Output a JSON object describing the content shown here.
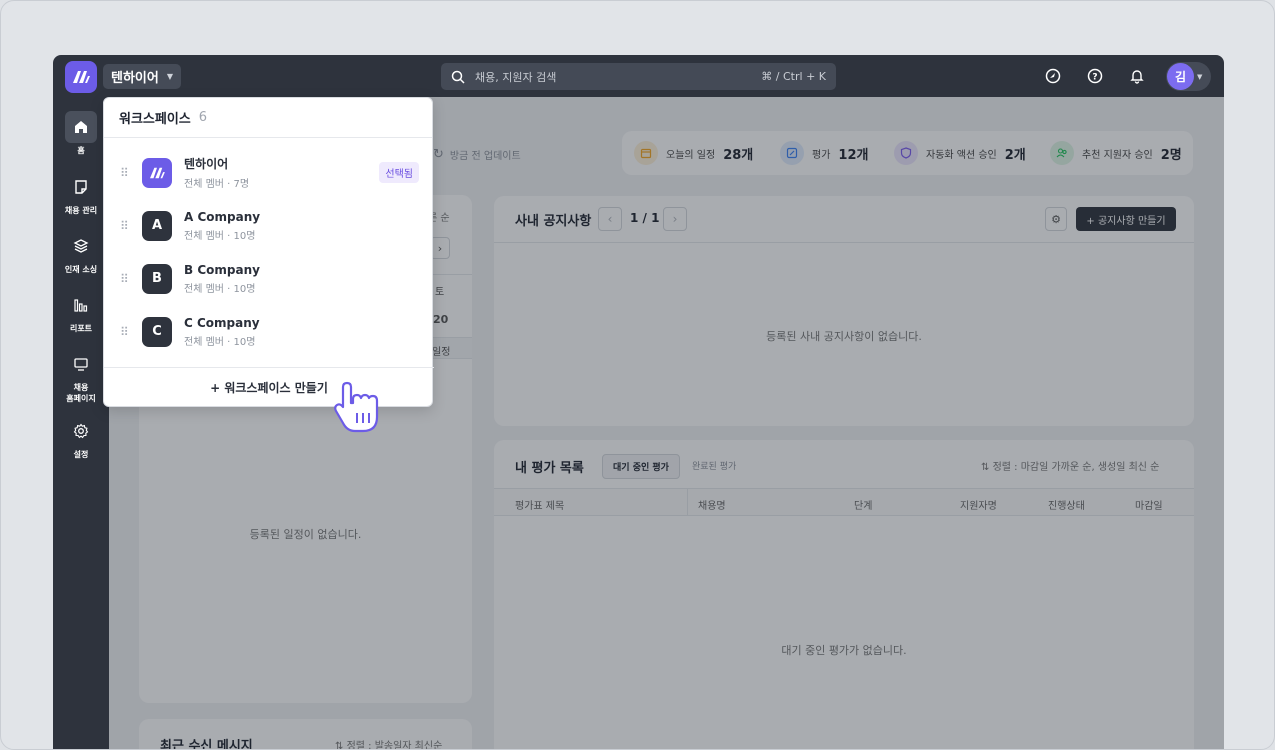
{
  "topbar": {
    "workspace_name": "텐하이어",
    "search_placeholder": "채용, 지원자 검색",
    "search_shortcut": "⌘ / Ctrl + K",
    "avatar_initial": "김"
  },
  "sidebar": {
    "items": [
      {
        "label": "홈",
        "icon": "home-icon"
      },
      {
        "label": "채용 관리",
        "icon": "note-icon"
      },
      {
        "label": "인재 소싱",
        "icon": "layers-icon"
      },
      {
        "label": "리포트",
        "icon": "bar-chart-icon"
      },
      {
        "label": "채용\n홈페이지",
        "icon": "monitor-icon"
      },
      {
        "label": "설정",
        "icon": "gear-icon"
      }
    ]
  },
  "main": {
    "refresh_text": "방금 전 업데이트",
    "stats": [
      {
        "label": "오늘의 일정",
        "value": "28개",
        "color": "#f5a623"
      },
      {
        "label": "평가",
        "value": "12개",
        "color": "#3b82f6"
      },
      {
        "label": "자동화 액션 승인",
        "value": "2개",
        "color": "#7c5cf0"
      },
      {
        "label": "추천 지원자 승인",
        "value": "2명",
        "color": "#22c55e"
      }
    ],
    "calendar": {
      "sort_text": "른 순",
      "day_label": "토",
      "day_number": "20",
      "col_label": "일정",
      "empty_text": "등록된 일정이 없습니다."
    },
    "notice": {
      "title": "사내 공지사항",
      "page": "1 / 1",
      "create_button": "+ 공지사항 만들기",
      "empty_text": "등록된 사내 공지사항이 없습니다."
    },
    "evaluations": {
      "title": "내 평가 목록",
      "tab_waiting": "대기 중인 평가",
      "tab_done": "완료된 평가",
      "sort_text": "정렬 : 마감일 가까운 순, 생성일 최신 순",
      "columns": [
        "평가표 제목",
        "채용명",
        "단계",
        "지원자명",
        "진행상태",
        "마감일"
      ],
      "empty_text": "대기 중인 평가가 없습니다."
    },
    "messages": {
      "title": "최근 수신 메시지",
      "sort_text": "정렬 : 발송일자 최신순"
    }
  },
  "dropdown": {
    "title": "워크스페이스",
    "count": "6",
    "items": [
      {
        "name": "텐하이어",
        "sub": "전체 멤버 · 7명",
        "badge": "선택됨",
        "initial": "",
        "color": "#6c5ce7"
      },
      {
        "name": "A Company",
        "sub": "전체 멤버 · 10명",
        "initial": "A",
        "color": "#2e333d"
      },
      {
        "name": "B Company",
        "sub": "전체 멤버 · 10명",
        "initial": "B",
        "color": "#2e333d"
      },
      {
        "name": "C Company",
        "sub": "전체 멤버 · 10명",
        "initial": "C",
        "color": "#2e333d"
      }
    ],
    "create_label": "+ 워크스페이스 만들기"
  }
}
